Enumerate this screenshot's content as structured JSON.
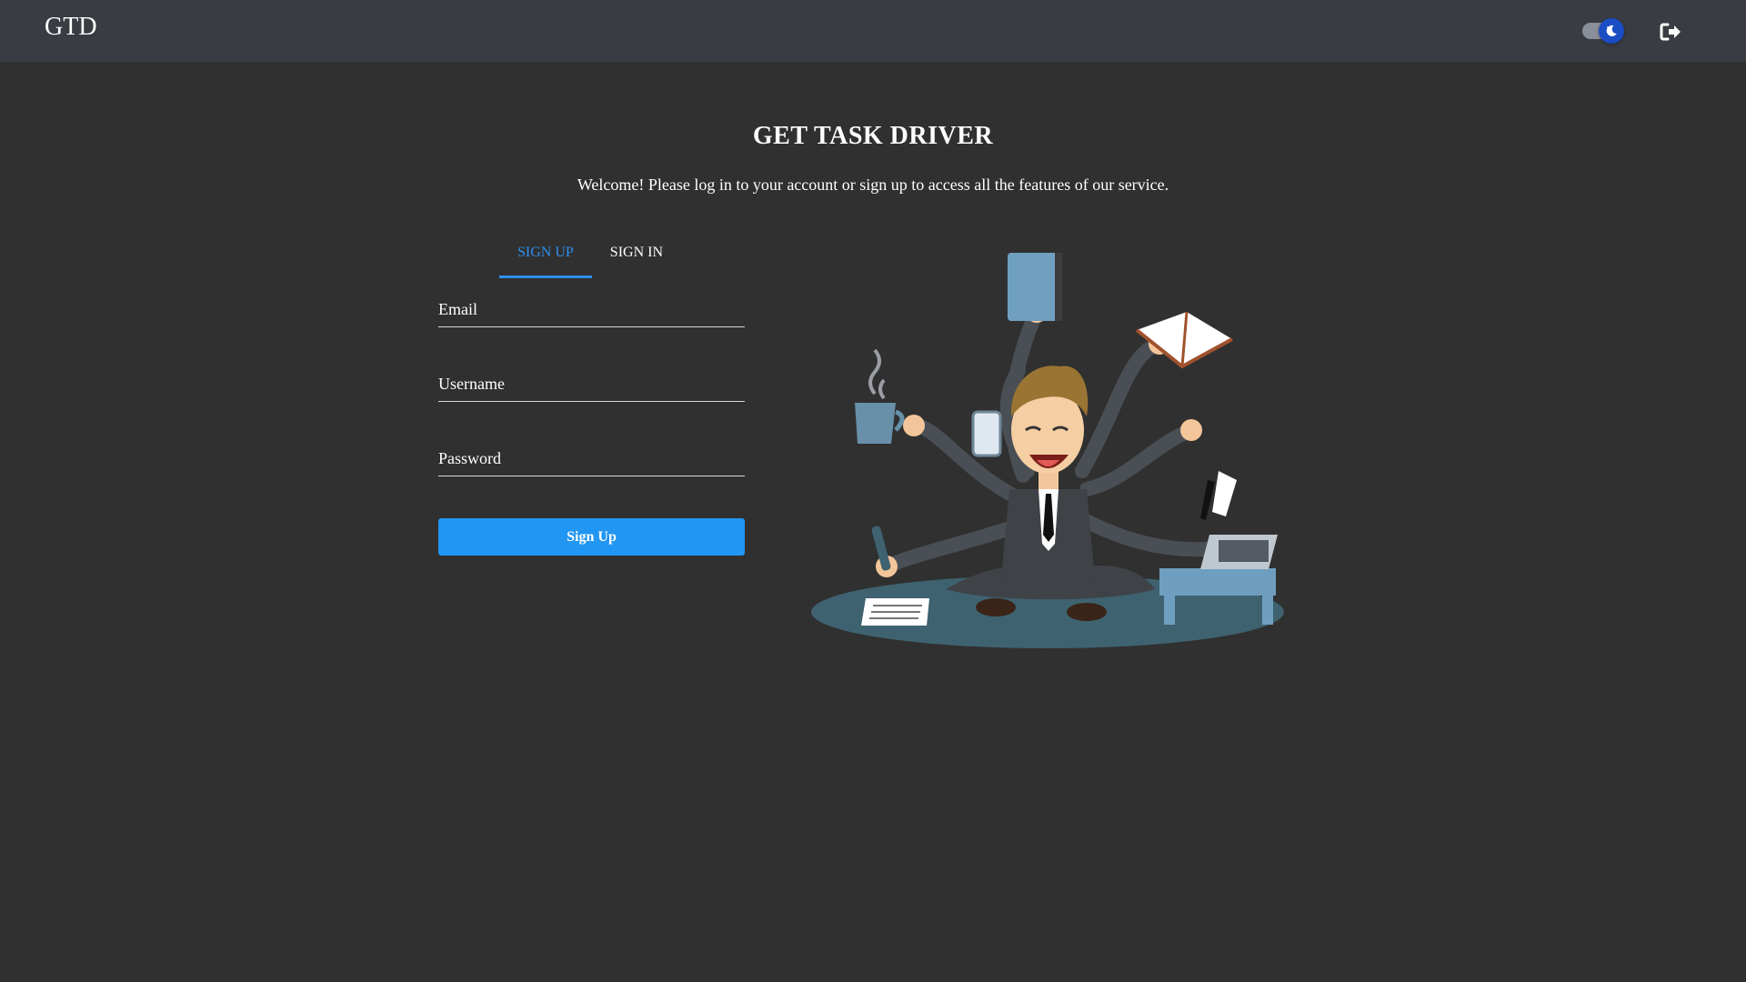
{
  "header": {
    "brand": "GTD",
    "theme_toggle_icon": "moon-icon",
    "logout_icon": "sign-out-icon"
  },
  "hero": {
    "title": "GET TASK DRIVER",
    "subtitle": "Welcome! Please log in to your account or sign up to access all the features of our service."
  },
  "auth": {
    "tabs": [
      {
        "label": "SIGN UP",
        "active": true
      },
      {
        "label": "SIGN IN",
        "active": false
      }
    ],
    "fields": {
      "email": {
        "placeholder": "Email",
        "value": ""
      },
      "username": {
        "placeholder": "Username",
        "value": ""
      },
      "password": {
        "placeholder": "Password",
        "value": ""
      }
    },
    "submit_label": "Sign Up"
  },
  "illustration": {
    "icon": "multitasking-businessman-illustration"
  },
  "colors": {
    "background": "#303030",
    "header": "#393c42",
    "accent": "#2196f3",
    "tab_active": "#2e8ff0"
  }
}
